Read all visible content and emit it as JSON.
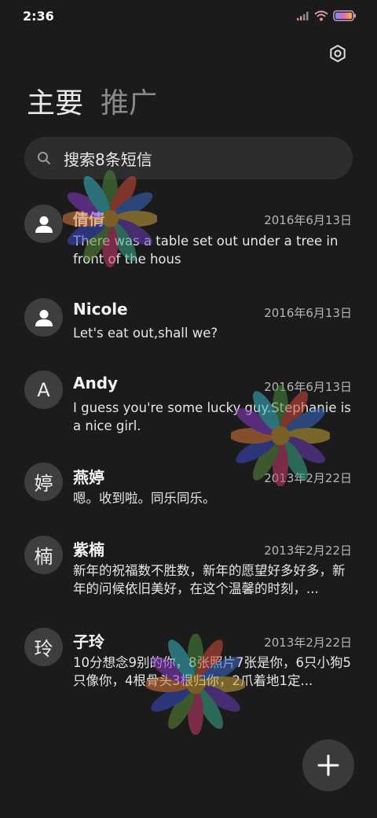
{
  "status": {
    "time": "2:36"
  },
  "tabs": {
    "main": "主要",
    "promo": "推广"
  },
  "search": {
    "label": "搜索8条短信"
  },
  "messages": [
    {
      "avatar": "",
      "avatar_icon": "person-icon",
      "name": "倩倩",
      "date": "2016年6月13日",
      "preview": "There was a table set out under a tree in front of the hous"
    },
    {
      "avatar": "",
      "avatar_icon": "person-icon",
      "name": "Nicole",
      "date": "2016年6月13日",
      "preview": "Let's eat out,shall we?"
    },
    {
      "avatar": "A",
      "name": "Andy",
      "date": "2016年6月13日",
      "preview": "I guess you're some lucky guy.Stephanie is a nice girl."
    },
    {
      "avatar": "婷",
      "name": "燕婷",
      "date": "2013年2月22日",
      "preview": "嗯。收到啦。同乐同乐。"
    },
    {
      "avatar": "楠",
      "name": "紫楠",
      "date": "2013年2月22日",
      "preview": "新年的祝福数不胜数，新年的愿望好多好多，新年的问候依旧美好，在这个温馨的时刻，..."
    },
    {
      "avatar": "玲",
      "name": "子玲",
      "date": "2013年2月22日",
      "preview": "10分想念9别的你，8张照片7张是你，6只小狗5只像你，4根骨头3根归你，2爪着地1定..."
    }
  ],
  "fab": {
    "icon": "plus-icon"
  }
}
